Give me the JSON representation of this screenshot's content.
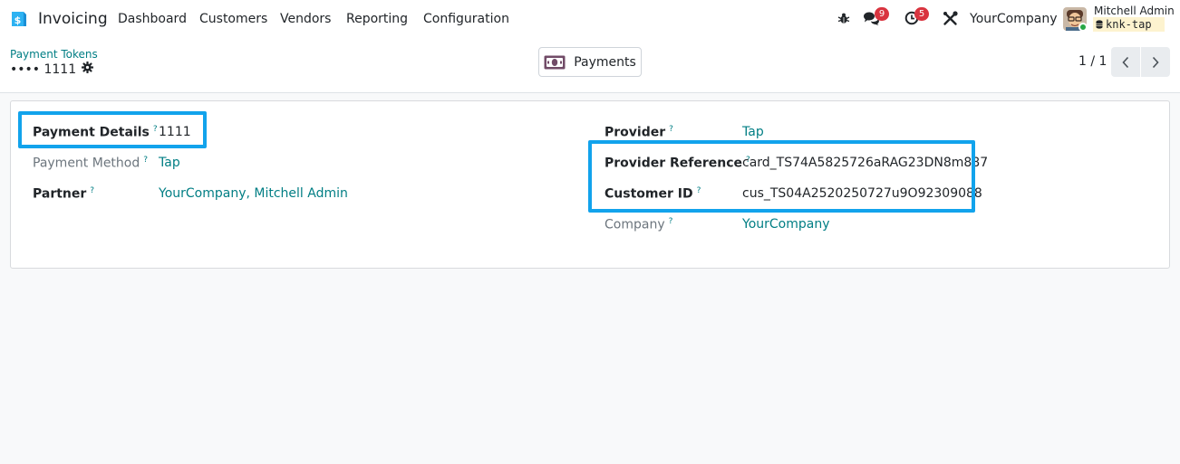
{
  "navbar": {
    "app_name": "Invoicing",
    "menu": [
      "Dashboard",
      "Customers",
      "Vendors",
      "Reporting",
      "Configuration"
    ],
    "messages_count": "9",
    "activities_count": "5",
    "company": "YourCompany",
    "user_name": "Mitchell Admin",
    "database": "knk-tap"
  },
  "control_panel": {
    "breadcrumb": "Payment Tokens",
    "record_name": "•••• 1111",
    "smart_button": "Payments",
    "pager": "1 / 1"
  },
  "form": {
    "payment_details": {
      "label": "Payment Details",
      "help": "?",
      "value": "1111"
    },
    "payment_method": {
      "label": "Payment Method",
      "help": "?",
      "value": "Tap"
    },
    "partner": {
      "label": "Partner",
      "help": "?",
      "value": "YourCompany, Mitchell Admin"
    },
    "provider": {
      "label": "Provider",
      "help": "?",
      "value": "Tap"
    },
    "provider_reference": {
      "label": "Provider Reference",
      "help": "?",
      "value": "card_TS74A5825726aRAG23DN8m887"
    },
    "customer_id": {
      "label": "Customer ID",
      "help": "?",
      "value": "cus_TS04A2520250727u9O92309088"
    },
    "company": {
      "label": "Company",
      "help": "?",
      "value": "YourCompany"
    }
  },
  "colors": {
    "accent": "#017e84",
    "highlight": "#12a3ec",
    "badge": "#d9343f"
  }
}
